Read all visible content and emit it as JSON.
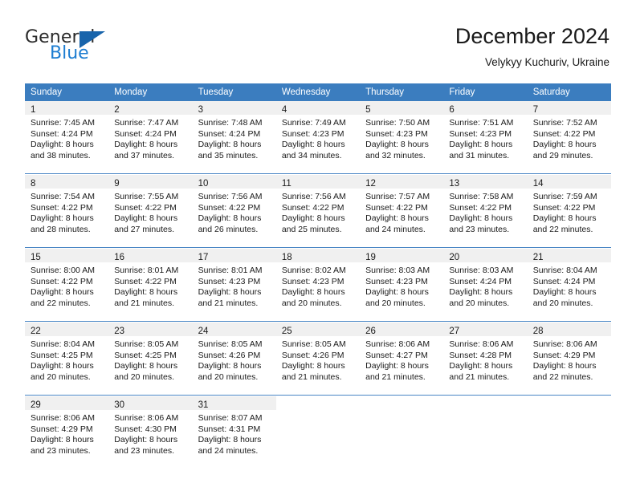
{
  "brand": {
    "name_part1": "General",
    "name_part2": "Blue",
    "triangle_color": "#1864ab",
    "blue_color": "#1d7dd1"
  },
  "header": {
    "month_title": "December 2024",
    "location": "Velykyy Kuchuriv, Ukraine"
  },
  "theme": {
    "header_blue": "#3b7dbf",
    "separator_blue": "#4a86c5",
    "daynum_band": "#f0f0f0"
  },
  "weekdays": [
    "Sunday",
    "Monday",
    "Tuesday",
    "Wednesday",
    "Thursday",
    "Friday",
    "Saturday"
  ],
  "weeks": [
    [
      {
        "day": "1",
        "sunrise": "Sunrise: 7:45 AM",
        "sunset": "Sunset: 4:24 PM",
        "daylight1": "Daylight: 8 hours",
        "daylight2": "and 38 minutes."
      },
      {
        "day": "2",
        "sunrise": "Sunrise: 7:47 AM",
        "sunset": "Sunset: 4:24 PM",
        "daylight1": "Daylight: 8 hours",
        "daylight2": "and 37 minutes."
      },
      {
        "day": "3",
        "sunrise": "Sunrise: 7:48 AM",
        "sunset": "Sunset: 4:24 PM",
        "daylight1": "Daylight: 8 hours",
        "daylight2": "and 35 minutes."
      },
      {
        "day": "4",
        "sunrise": "Sunrise: 7:49 AM",
        "sunset": "Sunset: 4:23 PM",
        "daylight1": "Daylight: 8 hours",
        "daylight2": "and 34 minutes."
      },
      {
        "day": "5",
        "sunrise": "Sunrise: 7:50 AM",
        "sunset": "Sunset: 4:23 PM",
        "daylight1": "Daylight: 8 hours",
        "daylight2": "and 32 minutes."
      },
      {
        "day": "6",
        "sunrise": "Sunrise: 7:51 AM",
        "sunset": "Sunset: 4:23 PM",
        "daylight1": "Daylight: 8 hours",
        "daylight2": "and 31 minutes."
      },
      {
        "day": "7",
        "sunrise": "Sunrise: 7:52 AM",
        "sunset": "Sunset: 4:22 PM",
        "daylight1": "Daylight: 8 hours",
        "daylight2": "and 29 minutes."
      }
    ],
    [
      {
        "day": "8",
        "sunrise": "Sunrise: 7:54 AM",
        "sunset": "Sunset: 4:22 PM",
        "daylight1": "Daylight: 8 hours",
        "daylight2": "and 28 minutes."
      },
      {
        "day": "9",
        "sunrise": "Sunrise: 7:55 AM",
        "sunset": "Sunset: 4:22 PM",
        "daylight1": "Daylight: 8 hours",
        "daylight2": "and 27 minutes."
      },
      {
        "day": "10",
        "sunrise": "Sunrise: 7:56 AM",
        "sunset": "Sunset: 4:22 PM",
        "daylight1": "Daylight: 8 hours",
        "daylight2": "and 26 minutes."
      },
      {
        "day": "11",
        "sunrise": "Sunrise: 7:56 AM",
        "sunset": "Sunset: 4:22 PM",
        "daylight1": "Daylight: 8 hours",
        "daylight2": "and 25 minutes."
      },
      {
        "day": "12",
        "sunrise": "Sunrise: 7:57 AM",
        "sunset": "Sunset: 4:22 PM",
        "daylight1": "Daylight: 8 hours",
        "daylight2": "and 24 minutes."
      },
      {
        "day": "13",
        "sunrise": "Sunrise: 7:58 AM",
        "sunset": "Sunset: 4:22 PM",
        "daylight1": "Daylight: 8 hours",
        "daylight2": "and 23 minutes."
      },
      {
        "day": "14",
        "sunrise": "Sunrise: 7:59 AM",
        "sunset": "Sunset: 4:22 PM",
        "daylight1": "Daylight: 8 hours",
        "daylight2": "and 22 minutes."
      }
    ],
    [
      {
        "day": "15",
        "sunrise": "Sunrise: 8:00 AM",
        "sunset": "Sunset: 4:22 PM",
        "daylight1": "Daylight: 8 hours",
        "daylight2": "and 22 minutes."
      },
      {
        "day": "16",
        "sunrise": "Sunrise: 8:01 AM",
        "sunset": "Sunset: 4:22 PM",
        "daylight1": "Daylight: 8 hours",
        "daylight2": "and 21 minutes."
      },
      {
        "day": "17",
        "sunrise": "Sunrise: 8:01 AM",
        "sunset": "Sunset: 4:23 PM",
        "daylight1": "Daylight: 8 hours",
        "daylight2": "and 21 minutes."
      },
      {
        "day": "18",
        "sunrise": "Sunrise: 8:02 AM",
        "sunset": "Sunset: 4:23 PM",
        "daylight1": "Daylight: 8 hours",
        "daylight2": "and 20 minutes."
      },
      {
        "day": "19",
        "sunrise": "Sunrise: 8:03 AM",
        "sunset": "Sunset: 4:23 PM",
        "daylight1": "Daylight: 8 hours",
        "daylight2": "and 20 minutes."
      },
      {
        "day": "20",
        "sunrise": "Sunrise: 8:03 AM",
        "sunset": "Sunset: 4:24 PM",
        "daylight1": "Daylight: 8 hours",
        "daylight2": "and 20 minutes."
      },
      {
        "day": "21",
        "sunrise": "Sunrise: 8:04 AM",
        "sunset": "Sunset: 4:24 PM",
        "daylight1": "Daylight: 8 hours",
        "daylight2": "and 20 minutes."
      }
    ],
    [
      {
        "day": "22",
        "sunrise": "Sunrise: 8:04 AM",
        "sunset": "Sunset: 4:25 PM",
        "daylight1": "Daylight: 8 hours",
        "daylight2": "and 20 minutes."
      },
      {
        "day": "23",
        "sunrise": "Sunrise: 8:05 AM",
        "sunset": "Sunset: 4:25 PM",
        "daylight1": "Daylight: 8 hours",
        "daylight2": "and 20 minutes."
      },
      {
        "day": "24",
        "sunrise": "Sunrise: 8:05 AM",
        "sunset": "Sunset: 4:26 PM",
        "daylight1": "Daylight: 8 hours",
        "daylight2": "and 20 minutes."
      },
      {
        "day": "25",
        "sunrise": "Sunrise: 8:05 AM",
        "sunset": "Sunset: 4:26 PM",
        "daylight1": "Daylight: 8 hours",
        "daylight2": "and 21 minutes."
      },
      {
        "day": "26",
        "sunrise": "Sunrise: 8:06 AM",
        "sunset": "Sunset: 4:27 PM",
        "daylight1": "Daylight: 8 hours",
        "daylight2": "and 21 minutes."
      },
      {
        "day": "27",
        "sunrise": "Sunrise: 8:06 AM",
        "sunset": "Sunset: 4:28 PM",
        "daylight1": "Daylight: 8 hours",
        "daylight2": "and 21 minutes."
      },
      {
        "day": "28",
        "sunrise": "Sunrise: 8:06 AM",
        "sunset": "Sunset: 4:29 PM",
        "daylight1": "Daylight: 8 hours",
        "daylight2": "and 22 minutes."
      }
    ],
    [
      {
        "day": "29",
        "sunrise": "Sunrise: 8:06 AM",
        "sunset": "Sunset: 4:29 PM",
        "daylight1": "Daylight: 8 hours",
        "daylight2": "and 23 minutes."
      },
      {
        "day": "30",
        "sunrise": "Sunrise: 8:06 AM",
        "sunset": "Sunset: 4:30 PM",
        "daylight1": "Daylight: 8 hours",
        "daylight2": "and 23 minutes."
      },
      {
        "day": "31",
        "sunrise": "Sunrise: 8:07 AM",
        "sunset": "Sunset: 4:31 PM",
        "daylight1": "Daylight: 8 hours",
        "daylight2": "and 24 minutes."
      },
      null,
      null,
      null,
      null
    ]
  ]
}
